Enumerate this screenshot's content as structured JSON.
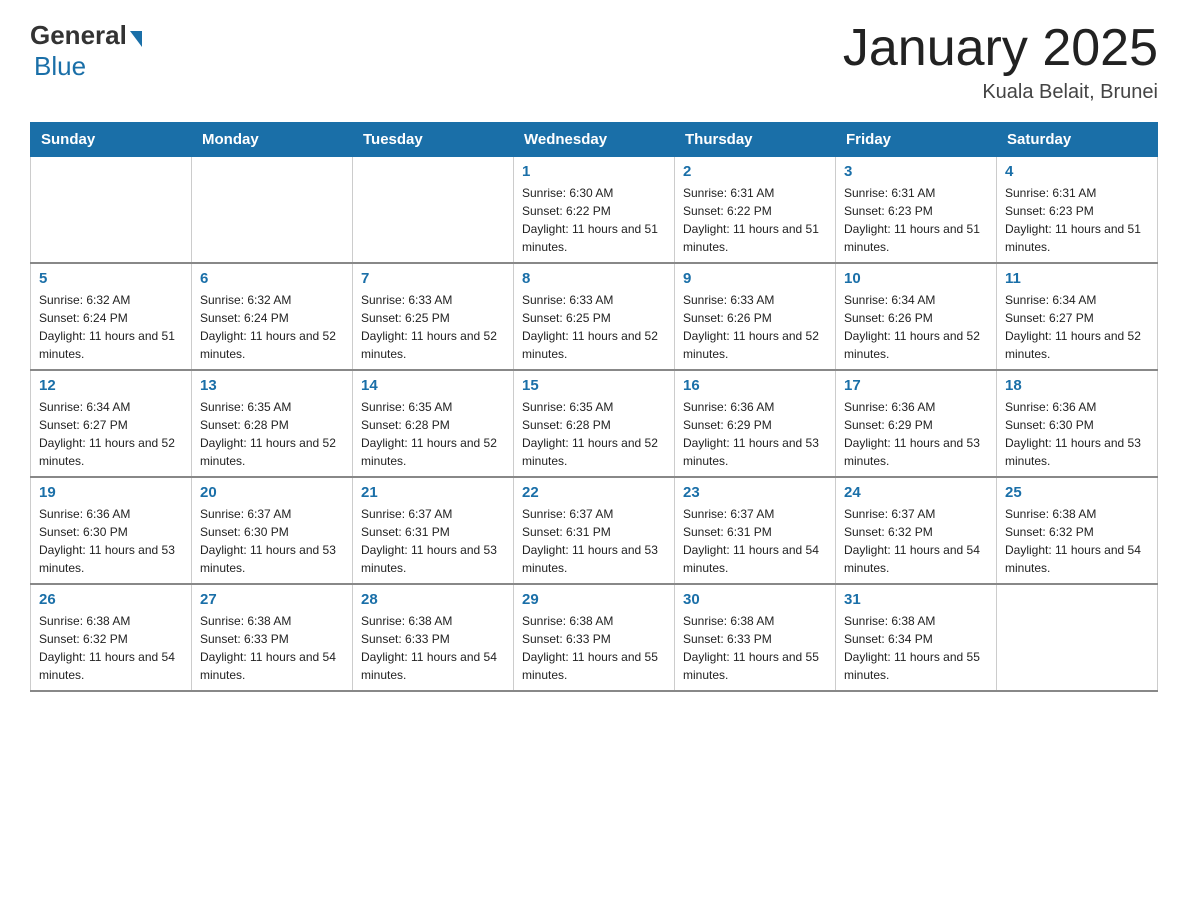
{
  "logo": {
    "general": "General",
    "blue": "Blue"
  },
  "header": {
    "title": "January 2025",
    "subtitle": "Kuala Belait, Brunei"
  },
  "days_of_week": [
    "Sunday",
    "Monday",
    "Tuesday",
    "Wednesday",
    "Thursday",
    "Friday",
    "Saturday"
  ],
  "weeks": [
    [
      {
        "day": "",
        "info": ""
      },
      {
        "day": "",
        "info": ""
      },
      {
        "day": "",
        "info": ""
      },
      {
        "day": "1",
        "info": "Sunrise: 6:30 AM\nSunset: 6:22 PM\nDaylight: 11 hours and 51 minutes."
      },
      {
        "day": "2",
        "info": "Sunrise: 6:31 AM\nSunset: 6:22 PM\nDaylight: 11 hours and 51 minutes."
      },
      {
        "day": "3",
        "info": "Sunrise: 6:31 AM\nSunset: 6:23 PM\nDaylight: 11 hours and 51 minutes."
      },
      {
        "day": "4",
        "info": "Sunrise: 6:31 AM\nSunset: 6:23 PM\nDaylight: 11 hours and 51 minutes."
      }
    ],
    [
      {
        "day": "5",
        "info": "Sunrise: 6:32 AM\nSunset: 6:24 PM\nDaylight: 11 hours and 51 minutes."
      },
      {
        "day": "6",
        "info": "Sunrise: 6:32 AM\nSunset: 6:24 PM\nDaylight: 11 hours and 52 minutes."
      },
      {
        "day": "7",
        "info": "Sunrise: 6:33 AM\nSunset: 6:25 PM\nDaylight: 11 hours and 52 minutes."
      },
      {
        "day": "8",
        "info": "Sunrise: 6:33 AM\nSunset: 6:25 PM\nDaylight: 11 hours and 52 minutes."
      },
      {
        "day": "9",
        "info": "Sunrise: 6:33 AM\nSunset: 6:26 PM\nDaylight: 11 hours and 52 minutes."
      },
      {
        "day": "10",
        "info": "Sunrise: 6:34 AM\nSunset: 6:26 PM\nDaylight: 11 hours and 52 minutes."
      },
      {
        "day": "11",
        "info": "Sunrise: 6:34 AM\nSunset: 6:27 PM\nDaylight: 11 hours and 52 minutes."
      }
    ],
    [
      {
        "day": "12",
        "info": "Sunrise: 6:34 AM\nSunset: 6:27 PM\nDaylight: 11 hours and 52 minutes."
      },
      {
        "day": "13",
        "info": "Sunrise: 6:35 AM\nSunset: 6:28 PM\nDaylight: 11 hours and 52 minutes."
      },
      {
        "day": "14",
        "info": "Sunrise: 6:35 AM\nSunset: 6:28 PM\nDaylight: 11 hours and 52 minutes."
      },
      {
        "day": "15",
        "info": "Sunrise: 6:35 AM\nSunset: 6:28 PM\nDaylight: 11 hours and 52 minutes."
      },
      {
        "day": "16",
        "info": "Sunrise: 6:36 AM\nSunset: 6:29 PM\nDaylight: 11 hours and 53 minutes."
      },
      {
        "day": "17",
        "info": "Sunrise: 6:36 AM\nSunset: 6:29 PM\nDaylight: 11 hours and 53 minutes."
      },
      {
        "day": "18",
        "info": "Sunrise: 6:36 AM\nSunset: 6:30 PM\nDaylight: 11 hours and 53 minutes."
      }
    ],
    [
      {
        "day": "19",
        "info": "Sunrise: 6:36 AM\nSunset: 6:30 PM\nDaylight: 11 hours and 53 minutes."
      },
      {
        "day": "20",
        "info": "Sunrise: 6:37 AM\nSunset: 6:30 PM\nDaylight: 11 hours and 53 minutes."
      },
      {
        "day": "21",
        "info": "Sunrise: 6:37 AM\nSunset: 6:31 PM\nDaylight: 11 hours and 53 minutes."
      },
      {
        "day": "22",
        "info": "Sunrise: 6:37 AM\nSunset: 6:31 PM\nDaylight: 11 hours and 53 minutes."
      },
      {
        "day": "23",
        "info": "Sunrise: 6:37 AM\nSunset: 6:31 PM\nDaylight: 11 hours and 54 minutes."
      },
      {
        "day": "24",
        "info": "Sunrise: 6:37 AM\nSunset: 6:32 PM\nDaylight: 11 hours and 54 minutes."
      },
      {
        "day": "25",
        "info": "Sunrise: 6:38 AM\nSunset: 6:32 PM\nDaylight: 11 hours and 54 minutes."
      }
    ],
    [
      {
        "day": "26",
        "info": "Sunrise: 6:38 AM\nSunset: 6:32 PM\nDaylight: 11 hours and 54 minutes."
      },
      {
        "day": "27",
        "info": "Sunrise: 6:38 AM\nSunset: 6:33 PM\nDaylight: 11 hours and 54 minutes."
      },
      {
        "day": "28",
        "info": "Sunrise: 6:38 AM\nSunset: 6:33 PM\nDaylight: 11 hours and 54 minutes."
      },
      {
        "day": "29",
        "info": "Sunrise: 6:38 AM\nSunset: 6:33 PM\nDaylight: 11 hours and 55 minutes."
      },
      {
        "day": "30",
        "info": "Sunrise: 6:38 AM\nSunset: 6:33 PM\nDaylight: 11 hours and 55 minutes."
      },
      {
        "day": "31",
        "info": "Sunrise: 6:38 AM\nSunset: 6:34 PM\nDaylight: 11 hours and 55 minutes."
      },
      {
        "day": "",
        "info": ""
      }
    ]
  ]
}
